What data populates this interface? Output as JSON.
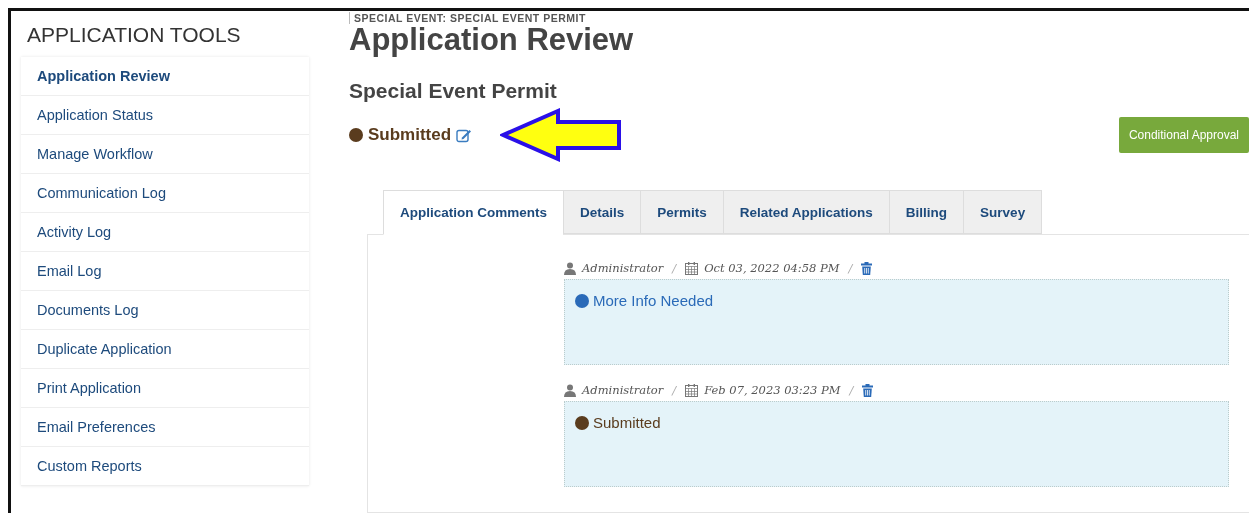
{
  "sidebar": {
    "title": "APPLICATION TOOLS",
    "items": [
      {
        "label": "Application Review",
        "selected": true
      },
      {
        "label": "Application Status",
        "selected": false
      },
      {
        "label": "Manage Workflow",
        "selected": false
      },
      {
        "label": "Communication Log",
        "selected": false
      },
      {
        "label": "Activity Log",
        "selected": false
      },
      {
        "label": "Email Log",
        "selected": false
      },
      {
        "label": "Documents Log",
        "selected": false
      },
      {
        "label": "Duplicate Application",
        "selected": false
      },
      {
        "label": "Print Application",
        "selected": false
      },
      {
        "label": "Email Preferences",
        "selected": false
      },
      {
        "label": "Custom Reports",
        "selected": false
      }
    ]
  },
  "header": {
    "breadcrumb": "SPECIAL EVENT: SPECIAL EVENT PERMIT",
    "title": "Application Review",
    "subtitle": "Special Event Permit"
  },
  "status": {
    "label": "Submitted",
    "color": "#5a3c1e"
  },
  "action_button": "Conditional Approval",
  "tabs": [
    {
      "label": "Application Comments",
      "selected": true
    },
    {
      "label": "Details",
      "selected": false
    },
    {
      "label": "Permits",
      "selected": false
    },
    {
      "label": "Related Applications",
      "selected": false
    },
    {
      "label": "Billing",
      "selected": false
    },
    {
      "label": "Survey",
      "selected": false
    }
  ],
  "comments": [
    {
      "author": "Administrator",
      "separator_1": "/",
      "date": "Oct 03, 2022 04:58 PM",
      "separator_2": "/",
      "status": "More Info Needed",
      "color": "#2a6ab8"
    },
    {
      "author": "Administrator",
      "separator_1": "/",
      "date": "Feb 07, 2023 03:23 PM",
      "separator_2": "/",
      "status": "Submitted",
      "color": "#5a3c1e"
    }
  ]
}
